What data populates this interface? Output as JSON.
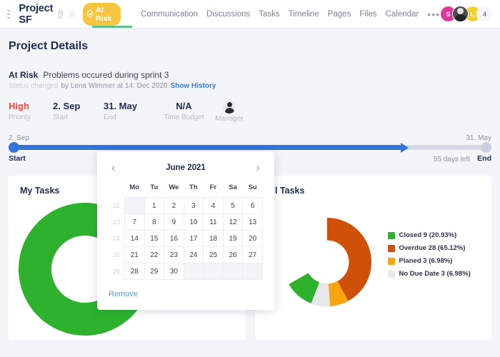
{
  "topbar": {
    "menu_icon": "hamburger-icon",
    "project_title": "Project SF",
    "help_icon": "question-circle-icon",
    "star_icon": "star-icon",
    "status_pill": {
      "label": "At Risk",
      "icon": "play-circle-icon",
      "bg": "#f7c53f"
    },
    "nav_items": [
      {
        "label": "Communication"
      },
      {
        "label": "Discussions"
      },
      {
        "label": "Tasks"
      },
      {
        "label": "Timeline"
      },
      {
        "label": "Pages"
      },
      {
        "label": "Files"
      },
      {
        "label": "Calendar"
      }
    ],
    "nav_more": "•••",
    "avatars": [
      {
        "initial": "S",
        "color": "#e0359a"
      },
      {
        "initial": "",
        "color": "#4b4b52"
      },
      {
        "initial": "L",
        "color": "#f3d02e"
      },
      {
        "initial": "4",
        "color": "#f6f7fa"
      }
    ]
  },
  "page": {
    "title": "Project Details",
    "status": {
      "name": "At Risk",
      "description": "Problems occured during sprint 3",
      "changed_label": "Status changed",
      "changed_by": "by Lena Wimmer at 14. Dec 2020",
      "history_link": "Show History"
    },
    "meta": [
      {
        "value": "High",
        "label": "Priority",
        "color": "#f0463c"
      },
      {
        "value": "2. Sep",
        "label": "Start",
        "color": "#1d2b4e"
      },
      {
        "value": "31. May",
        "label": "End",
        "color": "#1d2b4e"
      },
      {
        "value": "N/A",
        "label": "Time Budget",
        "color": "#1d2b4e"
      },
      {
        "value": "",
        "label": "Manager",
        "color": "#1d2b4e"
      }
    ],
    "timeline": {
      "start_date": "2. Sep",
      "start_label": "Start",
      "end_date": "31. May",
      "end_label": "End",
      "days_left": "55 days left",
      "fill_color": "#3273dc",
      "track_color": "#d4d9e4"
    }
  },
  "cards": [
    {
      "title": "My Tasks"
    },
    {
      "title": "All Tasks"
    }
  ],
  "calendar": {
    "prev_icon": "chevron-left-icon",
    "next_icon": "chevron-right-icon",
    "month": "June 2021",
    "weekdays": [
      "Mo",
      "Tu",
      "We",
      "Th",
      "Fr",
      "Sa",
      "Su"
    ],
    "weeks": [
      {
        "wk": "22",
        "days": [
          "",
          "1",
          "2",
          "3",
          "4",
          "5",
          "6"
        ]
      },
      {
        "wk": "23",
        "days": [
          "7",
          "8",
          "9",
          "10",
          "11",
          "12",
          "13"
        ]
      },
      {
        "wk": "24",
        "days": [
          "14",
          "15",
          "16",
          "17",
          "18",
          "19",
          "20"
        ]
      },
      {
        "wk": "25",
        "days": [
          "21",
          "22",
          "23",
          "24",
          "25",
          "26",
          "27"
        ]
      },
      {
        "wk": "26",
        "days": [
          "28",
          "29",
          "30",
          "",
          "",
          "",
          ""
        ]
      }
    ],
    "remove_label": "Remove"
  },
  "chart_data": [
    {
      "type": "pie",
      "title": "My Tasks",
      "categories": [
        "Closed"
      ],
      "values": [
        100
      ],
      "colors": [
        "#2eb22e"
      ],
      "legend": []
    },
    {
      "type": "pie",
      "title": "All Tasks",
      "categories": [
        "Closed",
        "Overdue",
        "Planed",
        "No Due Date"
      ],
      "values": [
        9,
        28,
        3,
        3
      ],
      "percentages": [
        20.93,
        65.12,
        6.98,
        6.98
      ],
      "colors": [
        "#2eb22e",
        "#cf5008",
        "#fca311",
        "#e7e8ea"
      ],
      "legend": [
        {
          "label": "Closed 9 (20.93%)",
          "color": "#2eb22e"
        },
        {
          "label": "Overdue 28 (65.12%)",
          "color": "#cf5008"
        },
        {
          "label": "Planed 3 (6.98%)",
          "color": "#fca311"
        },
        {
          "label": "No Due Date 3 (6.98%)",
          "color": "#e7e8ea"
        }
      ],
      "legend_position": "right"
    }
  ]
}
